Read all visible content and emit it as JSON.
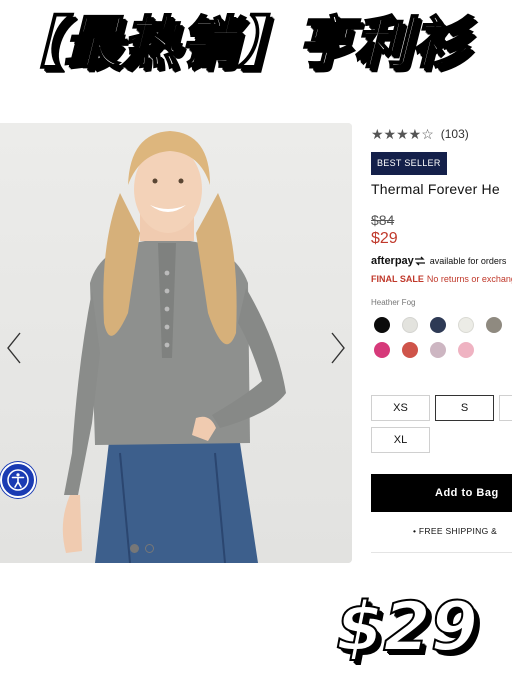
{
  "banner": {
    "title": "【最热销】亨利衫"
  },
  "gallery": {
    "prev_label": "‹",
    "next_label": "›",
    "image_alt": "Model wearing grey thermal henley with blue jeans",
    "dots": [
      {
        "active": true
      },
      {
        "active": false
      }
    ]
  },
  "accessibility": {
    "icon": "accessibility-icon"
  },
  "product": {
    "rating_stars": "★★★★☆",
    "rating_value": 4.5,
    "rating_count": "(103)",
    "badge": "BEST SELLER",
    "name": "Thermal Forever He",
    "original_price": "$84",
    "sale_price": "$29",
    "afterpay_logo": "afterpay",
    "afterpay_text": "available for orders",
    "final_sale_label": "FINAL SALE",
    "final_sale_text": "No returns or exchang",
    "color_label": "Heather Fog",
    "swatches": [
      "#0b0b0b",
      "#e3e3de",
      "#2e3a55",
      "#ecece6",
      "#8f8a80",
      "#d63a7a",
      "#cf544a",
      "#cdb6c2",
      "#efb3c2"
    ],
    "sizes": [
      {
        "label": "XS",
        "selected": false
      },
      {
        "label": "S",
        "selected": true
      },
      {
        "label": "XL",
        "selected": false
      }
    ],
    "add_to_bag": "Add to Bag",
    "shipping": "•  FREE SHIPPING &"
  },
  "price_overlay": {
    "text": "$29"
  },
  "colors": {
    "badge_bg": "#14204a",
    "sale_red": "#c0392b",
    "a11y_blue": "#1a3bb3"
  }
}
